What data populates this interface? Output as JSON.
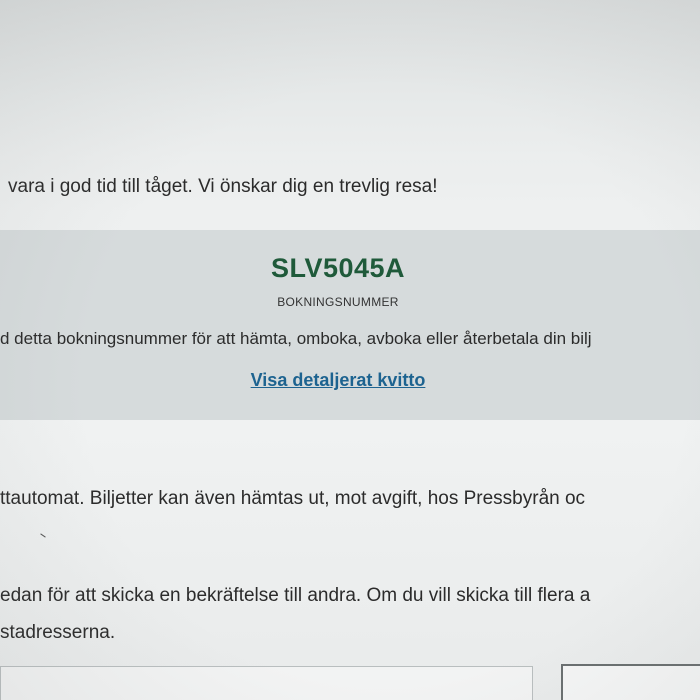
{
  "confirmation": {
    "welcome_text": "vara i god tid till tåget. Vi önskar dig en trevlig resa!",
    "booking": {
      "number": "SLV5045A",
      "caption": "BOKNINGSNUMMER",
      "usage_text": "d detta bokningsnummer för att hämta, omboka, avboka eller återbetala din bilj",
      "receipt_link": "Visa detaljerat kvitto"
    },
    "pickup_text": "ttautomat. Biljetter kan även hämtas ut, mot avgift, hos Pressbyrån oc",
    "share_text_line1": "edan för att skicka en bekräftelse till andra. Om du vill skicka till flera a",
    "share_text_line2": "stadresserna."
  },
  "colors": {
    "booking_number": "#1f5a3a",
    "link": "#1d6390",
    "booking_box_bg": "#d6dbdc"
  }
}
